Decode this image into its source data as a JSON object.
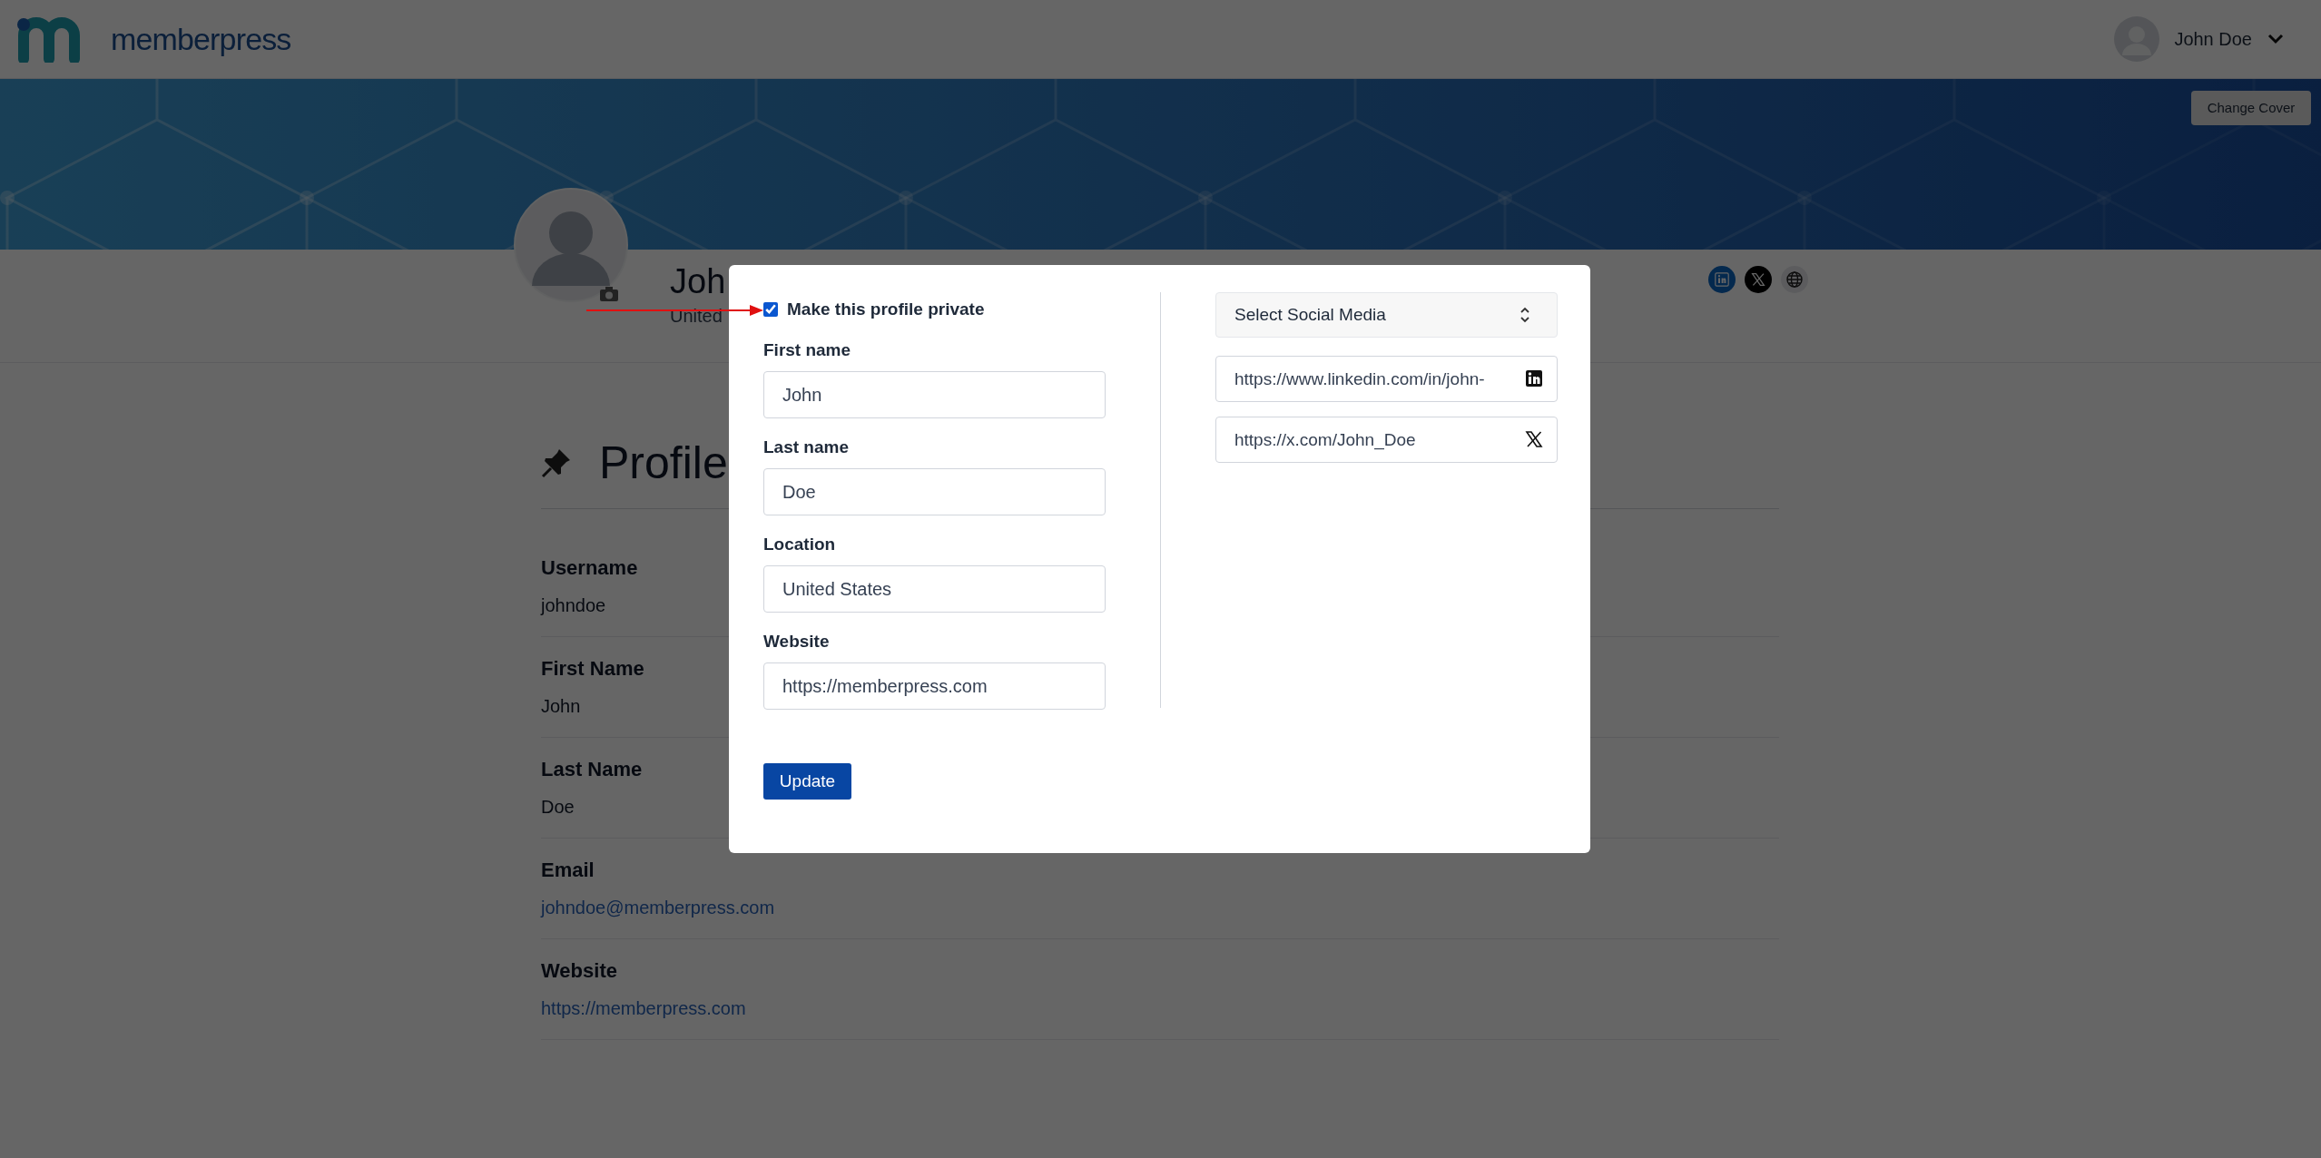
{
  "header": {
    "logo_text": "memberpress",
    "user_name": "John Doe"
  },
  "cover": {
    "button": "Change Cover"
  },
  "profile_header": {
    "name": "Joh",
    "location": "United",
    "social_links": [
      {
        "kind": "linkedin"
      },
      {
        "kind": "x"
      },
      {
        "kind": "website"
      }
    ]
  },
  "profile": {
    "title": "Profile",
    "fields": [
      {
        "label": "Username",
        "value": "johndoe",
        "kind": "text"
      },
      {
        "label": "First Name",
        "value": "John",
        "kind": "text"
      },
      {
        "label": "Last Name",
        "value": "Doe",
        "kind": "text"
      },
      {
        "label": "Email",
        "value": "johndoe@memberpress.com",
        "kind": "link"
      },
      {
        "label": "Website",
        "value": "https://memberpress.com",
        "kind": "link"
      }
    ]
  },
  "modal": {
    "private_toggle": {
      "label": "Make this profile private",
      "checked": true
    },
    "fields": [
      {
        "label": "First name",
        "value": "John"
      },
      {
        "label": "Last name",
        "value": "Doe"
      },
      {
        "label": "Location",
        "value": "United States"
      },
      {
        "label": "Website",
        "value": "https://memberpress.com"
      }
    ],
    "social_select": {
      "value": "Select Social Media"
    },
    "social_inputs": [
      {
        "kind": "linkedin",
        "value": "https://www.linkedin.com/in/john-"
      },
      {
        "kind": "x",
        "value": "https://x.com/John_Doe"
      }
    ],
    "submit": "Update"
  }
}
